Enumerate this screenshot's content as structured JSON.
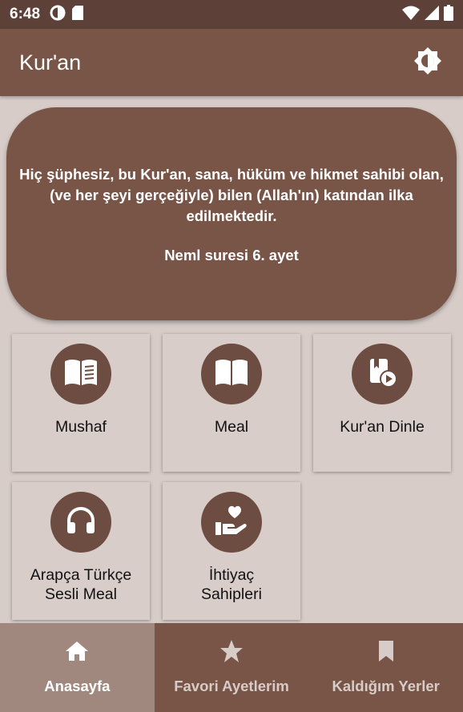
{
  "status_bar": {
    "time": "6:48"
  },
  "app_bar": {
    "title": "Kur'an"
  },
  "verse": {
    "text": "Hiç şüphesiz, bu Kur'an, sana, hüküm ve hikmet sahibi olan, (ve her şeyi gerçeğiyle) bilen (Allah'ın) katından ilka edilmektedir.",
    "reference": "Neml suresi 6. ayet"
  },
  "tiles": [
    {
      "label": "Mushaf",
      "icon": "book-open-text-icon"
    },
    {
      "label": "Meal",
      "icon": "book-open-icon"
    },
    {
      "label": "Kur'an Dinle",
      "icon": "book-play-icon"
    },
    {
      "label_line1": "Arapça Türkçe",
      "label_line2": "Sesli Meal",
      "icon": "headphones-icon"
    },
    {
      "label_line1": "İhtiyaç",
      "label_line2": "Sahipleri",
      "icon": "hand-heart-icon"
    }
  ],
  "bottom_nav": [
    {
      "label": "Anasayfa",
      "icon": "home-icon",
      "active": true
    },
    {
      "label": "Favori Ayetlerim",
      "icon": "star-icon",
      "active": false
    },
    {
      "label": "Kaldığım Yerler",
      "icon": "bookmark-icon",
      "active": false
    }
  ],
  "colors": {
    "status_bar": "#5d4037",
    "primary": "#795548",
    "tile_circle": "#6d4c41",
    "background": "#d7ccc8",
    "nav_active": "#a1887f"
  }
}
